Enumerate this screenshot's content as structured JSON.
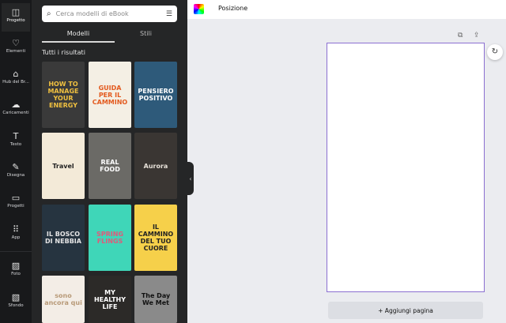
{
  "sidebar": {
    "items": [
      {
        "label": "Progetto",
        "icon": "layout-icon",
        "glyph": "◫"
      },
      {
        "label": "Elementi",
        "icon": "shapes-icon",
        "glyph": "♡"
      },
      {
        "label": "Hub del Br...",
        "icon": "brand-hub-icon",
        "glyph": "⌂"
      },
      {
        "label": "Caricamenti",
        "icon": "cloud-upload-icon",
        "glyph": "☁"
      },
      {
        "label": "Testo",
        "icon": "text-icon",
        "glyph": "T"
      },
      {
        "label": "Disegna",
        "icon": "draw-icon",
        "glyph": "✎"
      },
      {
        "label": "Progetti",
        "icon": "folder-icon",
        "glyph": "▭"
      },
      {
        "label": "App",
        "icon": "apps-grid-icon",
        "glyph": "⠿"
      },
      {
        "label": "Foto",
        "icon": "photo-icon",
        "glyph": "▨"
      },
      {
        "label": "Sfondo",
        "icon": "background-icon",
        "glyph": "▧"
      }
    ]
  },
  "panel": {
    "search_placeholder": "Cerca modelli di eBook",
    "tabs": [
      "Modelli",
      "Stili"
    ],
    "section_title": "Tutti i risultati",
    "templates": [
      {
        "title": "HOW TO MANAGE YOUR ENERGY",
        "bg": "#3a3a3a",
        "fg": "#f0c040"
      },
      {
        "title": "GUIDA PER IL CAMMINO",
        "bg": "#f4efe4",
        "fg": "#e35a1e"
      },
      {
        "title": "PENSIERO POSITIVO",
        "bg": "#2e5a7a",
        "fg": "#ffffff"
      },
      {
        "title": "Travel",
        "bg": "#f3ead8",
        "fg": "#222222"
      },
      {
        "title": "REAL FOOD",
        "bg": "#6b6a66",
        "fg": "#ffffff"
      },
      {
        "title": "Aurora",
        "bg": "#3a3633",
        "fg": "#e6e0d8"
      },
      {
        "title": "IL BOSCO DI NEBBIA",
        "bg": "#263440",
        "fg": "#e6e6e6"
      },
      {
        "title": "SPRING FLINGS",
        "bg": "#3fd6b8",
        "fg": "#e05a7a"
      },
      {
        "title": "IL CAMMINO DEL TUO CUORE",
        "bg": "#f6d04a",
        "fg": "#222222"
      },
      {
        "title": "sono ancora qui",
        "bg": "#f3ede6",
        "fg": "#b89a78"
      },
      {
        "title": "MY HEALTHY LIFE",
        "bg": "#2c2a28",
        "fg": "#ffffff"
      },
      {
        "title": "The Day We Met",
        "bg": "#8a8a8a",
        "fg": "#111111"
      }
    ]
  },
  "topbar": {
    "title": "Posizione"
  },
  "canvas": {
    "add_page": "+ Aggiungi pagina"
  }
}
